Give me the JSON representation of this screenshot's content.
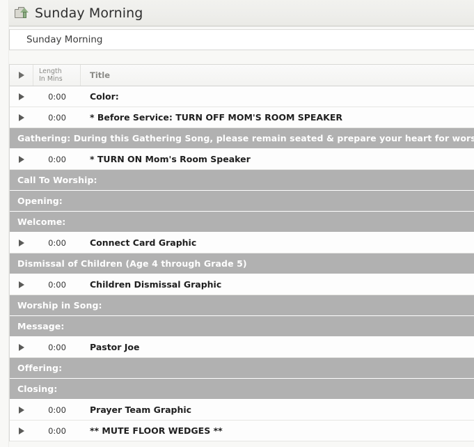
{
  "window": {
    "title": "Sunday Morning",
    "title_icon": "folder-upload-icon"
  },
  "name_field": {
    "value": "Sunday Morning",
    "placeholder": "Sunday Morning"
  },
  "table": {
    "columns": {
      "arrow": "play-column",
      "length_line1": "Length",
      "length_line2": "In Mins",
      "title": "Title"
    },
    "rows": [
      {
        "type": "item",
        "length": "0:00",
        "title": "Color:"
      },
      {
        "type": "item",
        "length": "0:00",
        "title": "* Before Service: TURN OFF MOM'S ROOM SPEAKER"
      },
      {
        "type": "section",
        "title": "Gathering: During this Gathering Song, please remain seated & prepare your heart for worship."
      },
      {
        "type": "item",
        "length": "0:00",
        "title": "* TURN ON Mom's Room Speaker"
      },
      {
        "type": "section",
        "title": "Call To Worship:"
      },
      {
        "type": "section",
        "title": "Opening:"
      },
      {
        "type": "section",
        "title": "Welcome:"
      },
      {
        "type": "item",
        "length": "0:00",
        "title": "Connect Card Graphic"
      },
      {
        "type": "section",
        "title": "Dismissal of Children (Age 4 through Grade 5)"
      },
      {
        "type": "item",
        "length": "0:00",
        "title": "Children Dismissal Graphic"
      },
      {
        "type": "section",
        "title": "Worship in Song:"
      },
      {
        "type": "section",
        "title": "Message:"
      },
      {
        "type": "item",
        "length": "0:00",
        "title": "Pastor Joe"
      },
      {
        "type": "section",
        "title": "Offering:"
      },
      {
        "type": "section",
        "title": "Closing:"
      },
      {
        "type": "item",
        "length": "0:00",
        "title": "Prayer Team Graphic"
      },
      {
        "type": "item",
        "length": "0:00",
        "title": "** MUTE FLOOR WEDGES **"
      }
    ]
  },
  "colors": {
    "section_row_bg": "#b1b1b1",
    "section_row_text": "#ffffff",
    "item_row_bg": "#fdfdfd",
    "page_bg": "#f8f8f6",
    "titlebar_bg": "#eeeeeb",
    "icon_accent_green": "#8fae85"
  }
}
